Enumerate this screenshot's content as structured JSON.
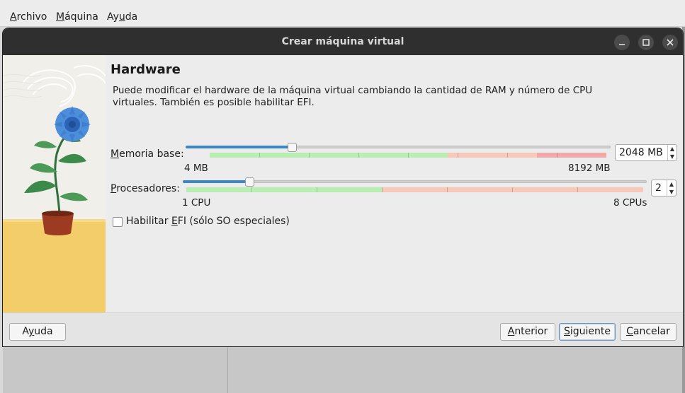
{
  "menubar": {
    "items": [
      {
        "label": "Archivo",
        "mnemonic": "A"
      },
      {
        "label": "Máquina",
        "mnemonic": "M"
      },
      {
        "label": "Ayuda",
        "mnemonic": "u"
      }
    ]
  },
  "dialog": {
    "title": "Crear máquina virtual",
    "heading": "Hardware",
    "description": "Puede modificar el hardware de la máquina virtual cambiando la cantidad de RAM y número de CPU virtuales. También es posible habilitar EFI."
  },
  "memory": {
    "label": "Memoria base:",
    "value": "2048 MB",
    "min_label": "4 MB",
    "max_label": "8192 MB",
    "level_fraction": 0.25
  },
  "processors": {
    "label": "Procesadores:",
    "value": "2",
    "min_label": "1 CPU",
    "max_label": "8 CPUs",
    "level_fraction": 0.1429
  },
  "efi": {
    "label": "Habilitar EFI (sólo SO especiales)",
    "checked": false
  },
  "buttons": {
    "help": "Ayuda",
    "back": "Anterior",
    "next": "Siguiente",
    "cancel": "Cancelar"
  },
  "window_controls": {
    "minimize_icon": "minimize-icon",
    "maximize_icon": "maximize-icon",
    "close_icon": "close-icon"
  },
  "colors": {
    "slider_fill": "#3d86c6",
    "scale_green": "#b9eeb3",
    "scale_orange": "#f6c9b8",
    "scale_red": "#f1a9a9",
    "titlebar": "#2f2f2f",
    "illustration_floor": "#f2cd6a",
    "flower": "#3f7fd0",
    "pot": "#9c3b22"
  }
}
